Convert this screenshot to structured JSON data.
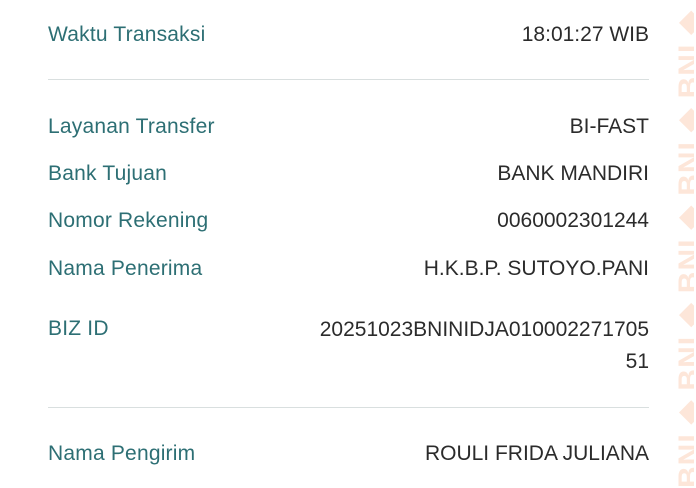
{
  "section1": {
    "waktu_label": "Waktu Transaksi",
    "waktu_value": "18:01:27 WIB"
  },
  "section2": {
    "layanan_label": "Layanan Transfer",
    "layanan_value": "BI-FAST",
    "bank_label": "Bank Tujuan",
    "bank_value": "BANK MANDIRI",
    "rekening_label": "Nomor Rekening",
    "rekening_value": "0060002301244",
    "penerima_label": "Nama Penerima",
    "penerima_value": "H.K.B.P. SUTOYO.PANI",
    "biz_label": "BIZ ID",
    "biz_value": "20251023BNINIDJA01000227170551"
  },
  "section3": {
    "pengirim_label": "Nama Pengirim",
    "pengirim_value": "ROULI FRIDA JULIANA"
  },
  "watermark": {
    "text": "BNI ◆ BNI ◆ BNI ◆ BNI ◆ BNI ◆ BNI",
    "color": "#f5732d"
  }
}
